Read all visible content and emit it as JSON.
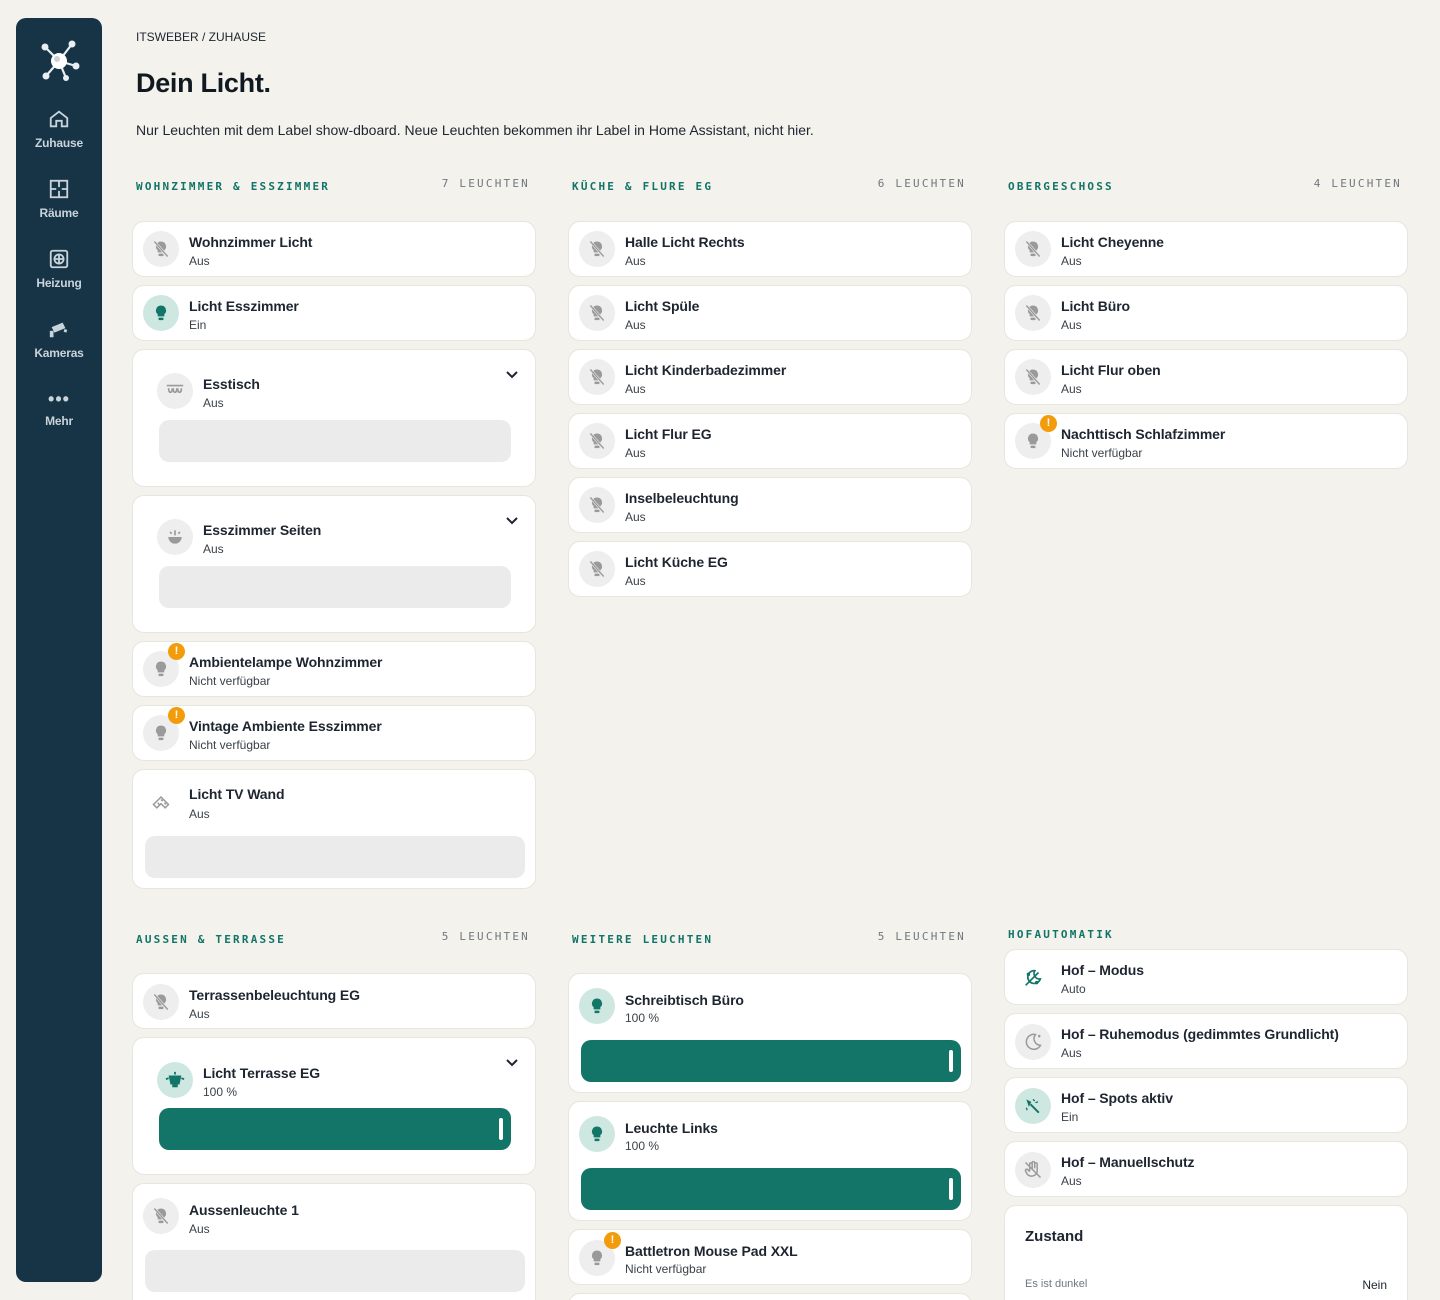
{
  "sidebar": {
    "nav": [
      {
        "label": "Zuhause",
        "icon": "home-icon"
      },
      {
        "label": "Räume",
        "icon": "floorplan-icon"
      },
      {
        "label": "Heizung",
        "icon": "heater-icon"
      },
      {
        "label": "Kameras",
        "icon": "camera-icon"
      },
      {
        "label": "Mehr",
        "icon": "more-icon"
      }
    ]
  },
  "header": {
    "breadcrumb": "ITSWEBER / ZUHAUSE",
    "title": "Dein Licht.",
    "description": "Nur Leuchten mit dem Label show-dboard. Neue Leuchten bekommen ihr Label in Home Assistant, nicht hier."
  },
  "sections": {
    "wohnzimmer": {
      "title": "WOHNZIMMER & ESSZIMMER",
      "count": "7 LEUCHTEN",
      "items": [
        {
          "name": "Wohnzimmer Licht",
          "state": "Aus",
          "icon": "bulb-off-icon"
        },
        {
          "name": "Licht Esszimmer",
          "state": "Ein",
          "icon": "bulb-on-icon"
        },
        {
          "name": "Esstisch",
          "state": "Aus",
          "icon": "chandelier-icon"
        },
        {
          "name": "Esszimmer Seiten",
          "state": "Aus",
          "icon": "ceiling-light-icon"
        },
        {
          "name": "Ambientelampe Wohnzimmer",
          "state": "Nicht verfügbar",
          "icon": "bulb-warning-icon",
          "warning": "!"
        },
        {
          "name": "Vintage Ambiente Esszimmer",
          "state": "Nicht verfügbar",
          "icon": "bulb-warning-icon",
          "warning": "!"
        },
        {
          "name": "Licht TV Wand",
          "state": "Aus",
          "icon": "led-strip-icon"
        }
      ]
    },
    "kueche": {
      "title": "KÜCHE & FLURE EG",
      "count": "6 LEUCHTEN",
      "items": [
        {
          "name": "Halle Licht Rechts",
          "state": "Aus",
          "icon": "bulb-off-icon"
        },
        {
          "name": "Licht Spüle",
          "state": "Aus",
          "icon": "bulb-off-icon"
        },
        {
          "name": "Licht Kinderbadezimmer",
          "state": "Aus",
          "icon": "bulb-off-icon"
        },
        {
          "name": "Licht Flur EG",
          "state": "Aus",
          "icon": "bulb-off-icon"
        },
        {
          "name": "Inselbeleuchtung",
          "state": "Aus",
          "icon": "bulb-off-icon"
        },
        {
          "name": "Licht Küche EG",
          "state": "Aus",
          "icon": "bulb-off-icon"
        }
      ]
    },
    "obergeschoss": {
      "title": "OBERGESCHOSS",
      "count": "4 LEUCHTEN",
      "items": [
        {
          "name": "Licht Cheyenne",
          "state": "Aus",
          "icon": "bulb-off-icon"
        },
        {
          "name": "Licht Büro",
          "state": "Aus",
          "icon": "bulb-off-icon"
        },
        {
          "name": "Licht Flur oben",
          "state": "Aus",
          "icon": "bulb-off-icon"
        },
        {
          "name": "Nachttisch Schlafzimmer",
          "state": "Nicht verfügbar",
          "icon": "bulb-warning-icon",
          "warning": "!"
        }
      ]
    },
    "aussen": {
      "title": "AUSSEN & TERRASSE",
      "count": "5 LEUCHTEN",
      "items": [
        {
          "name": "Terrassenbeleuchtung EG",
          "state": "Aus",
          "icon": "bulb-off-icon"
        },
        {
          "name": "Licht Terrasse EG",
          "state": "100 %",
          "icon": "outdoor-lamp-icon",
          "brightness": 100
        },
        {
          "name": "Aussenleuchte 1",
          "state": "Aus",
          "icon": "bulb-off-icon"
        }
      ]
    },
    "weitere": {
      "title": "WEITERE LEUCHTEN",
      "count": "5 LEUCHTEN",
      "items": [
        {
          "name": "Schreibtisch Büro",
          "state": "100 %",
          "icon": "bulb-on-icon",
          "brightness": 100
        },
        {
          "name": "Leuchte Links",
          "state": "100 %",
          "icon": "bulb-on-icon",
          "brightness": 100
        },
        {
          "name": "Battletron Mouse Pad XXL",
          "state": "Nicht verfügbar",
          "icon": "bulb-warning-icon",
          "warning": "!"
        }
      ]
    },
    "hof": {
      "title": "HOFAUTOMATIK",
      "items": [
        {
          "name": "Hof – Modus",
          "state": "Auto",
          "icon": "auto-weather-icon"
        },
        {
          "name": "Hof – Ruhemodus (gedimmtes Grundlicht)",
          "state": "Aus",
          "icon": "moon-icon"
        },
        {
          "name": "Hof – Spots aktiv",
          "state": "Ein",
          "icon": "spotlight-icon"
        },
        {
          "name": "Hof – Manuellschutz",
          "state": "Aus",
          "icon": "hand-off-icon"
        }
      ],
      "zustand": {
        "title": "Zustand",
        "rows": [
          {
            "label": "Es ist dunkel",
            "value": "Nein"
          }
        ]
      }
    }
  },
  "colors": {
    "accent": "#137567",
    "sidebar": "#163446",
    "warning": "#f29c0b",
    "background": "#f3f2ec"
  }
}
